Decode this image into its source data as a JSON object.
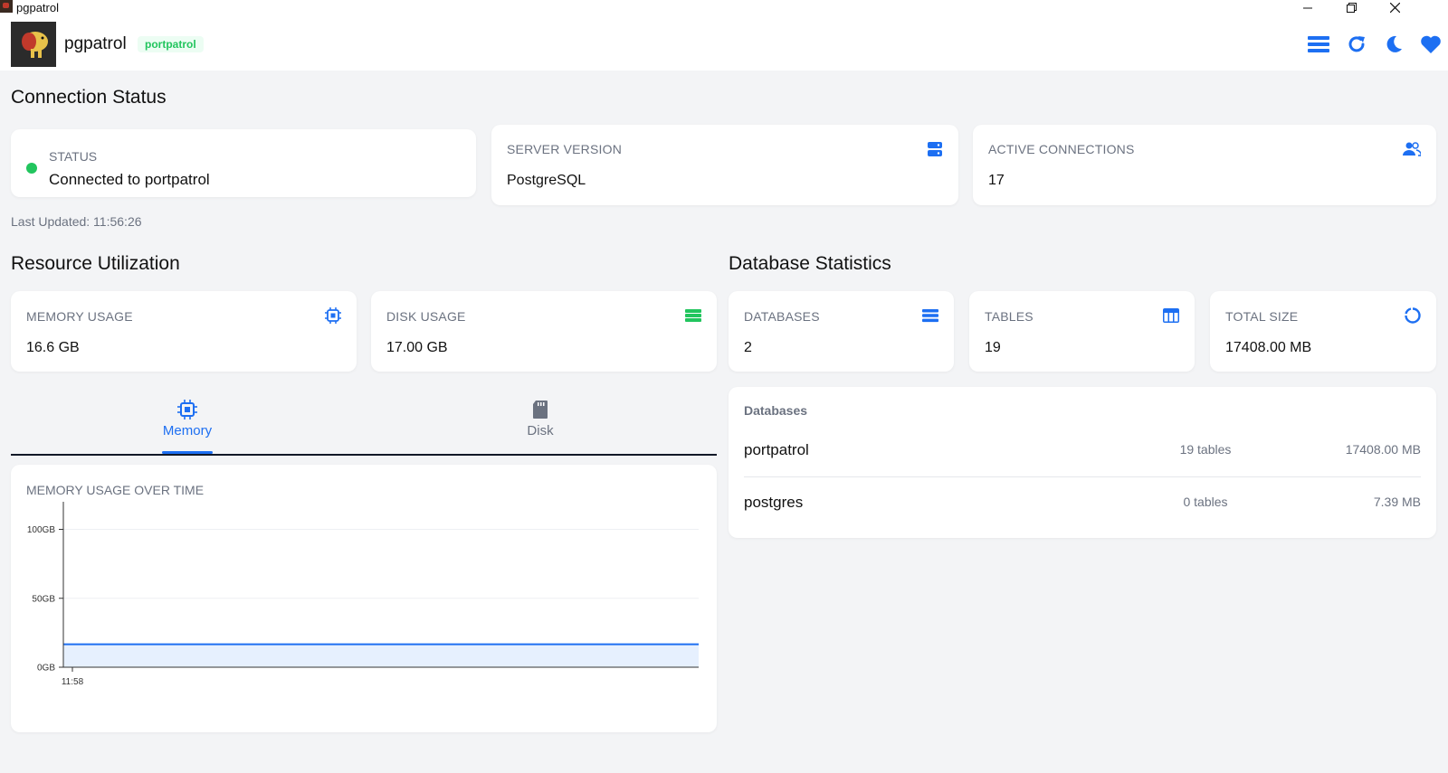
{
  "window": {
    "title": "pgpatrol"
  },
  "header": {
    "app_name": "pgpatrol",
    "badge": "portpatrol",
    "logo_text": "pgpatrol"
  },
  "connection": {
    "section_title": "Connection Status",
    "status_label": "STATUS",
    "status_text": "Connected to portpatrol",
    "server_version_label": "SERVER VERSION",
    "server_version_value": "PostgreSQL",
    "active_connections_label": "ACTIVE CONNECTIONS",
    "active_connections_value": "17",
    "last_updated": "Last Updated: 11:56:26"
  },
  "resources": {
    "section_title": "Resource Utilization",
    "memory_label": "MEMORY USAGE",
    "memory_value": "16.6 GB",
    "disk_label": "DISK USAGE",
    "disk_value": "17.00 GB",
    "tabs": [
      {
        "label": "Memory",
        "active": true
      },
      {
        "label": "Disk",
        "active": false
      }
    ]
  },
  "database_stats": {
    "section_title": "Database Statistics",
    "databases_label": "DATABASES",
    "databases_value": "2",
    "tables_label": "TABLES",
    "tables_value": "19",
    "total_size_label": "TOTAL SIZE",
    "total_size_value": "17408.00 MB",
    "list_title": "Databases",
    "rows": [
      {
        "name": "portpatrol",
        "tables": "19 tables",
        "size": "17408.00 MB"
      },
      {
        "name": "postgres",
        "tables": "0 tables",
        "size": "7.39 MB"
      }
    ]
  },
  "colors": {
    "accent": "#1d6ff2",
    "success": "#22c55e",
    "background": "#f3f4f6"
  },
  "chart_data": {
    "type": "area",
    "title": "MEMORY USAGE OVER TIME",
    "x": [
      "11:58"
    ],
    "x_ticks": [
      "11:58"
    ],
    "series": [
      {
        "values": [
          16.6,
          16.6
        ]
      }
    ],
    "y_ticks": [
      "0GB",
      "50GB",
      "100GB"
    ],
    "y_tick_values": [
      0,
      50,
      100
    ],
    "ylim": [
      0,
      120
    ],
    "grid": true,
    "color": "#1d6ff2"
  }
}
